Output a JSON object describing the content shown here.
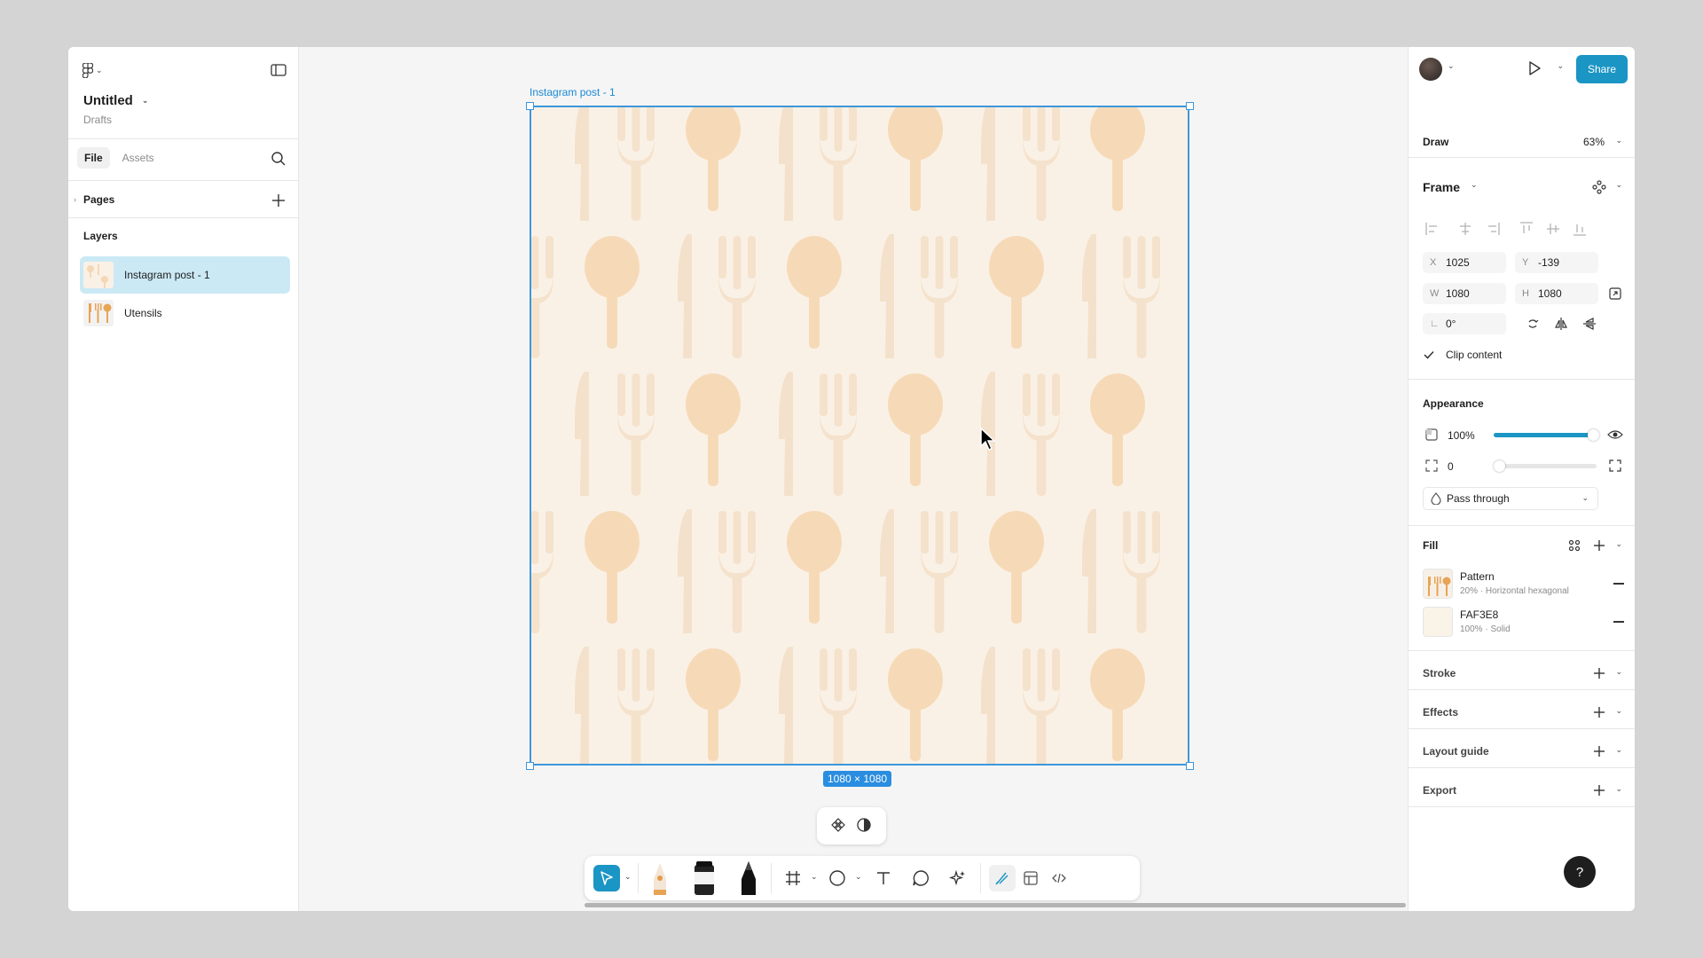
{
  "file": {
    "title": "Untitled",
    "location": "Drafts"
  },
  "left_panel": {
    "tabs": [
      {
        "label": "File"
      },
      {
        "label": "Assets"
      }
    ],
    "pages_label": "Pages",
    "layers_label": "Layers",
    "layers": [
      {
        "label": "Instagram post - 1",
        "selected": true
      },
      {
        "label": "Utensils",
        "selected": false
      }
    ]
  },
  "canvas": {
    "frame_label": "Instagram post - 1",
    "dims_badge": "1080 × 1080",
    "background_color": "#FAF1E6",
    "selection_color": "#3D97DB"
  },
  "toolbar": {
    "tools": [
      "move-icon",
      "pen-icon",
      "marker-icon",
      "pencil-icon",
      "frame-icon",
      "ellipse-icon",
      "text-icon",
      "comment-icon",
      "ai-icon",
      "draw-mode-icon",
      "design-mode-icon",
      "dev-mode-icon"
    ]
  },
  "right_panel": {
    "share_label": "Share",
    "mode_label": "Draw",
    "zoom": "63%",
    "frame_label": "Frame",
    "position": {
      "x_label": "X",
      "x": "1025",
      "y_label": "Y",
      "y": "-139"
    },
    "size": {
      "w_label": "W",
      "w": "1080",
      "h_label": "H",
      "h": "1080"
    },
    "rotation": "0°",
    "clip_content": "Clip content",
    "appearance_label": "Appearance",
    "opacity": "100%",
    "opacity_level": 1.0,
    "corner_radius": "0",
    "blend_mode": "Pass through",
    "fill_label": "Fill",
    "fills": [
      {
        "name": "Pattern",
        "detail": "20% · Horizontal hexagonal"
      },
      {
        "name": "FAF3E8",
        "detail": "100% · Solid",
        "color": "#FAF3E8"
      }
    ],
    "stroke_label": "Stroke",
    "effects_label": "Effects",
    "layout_guide_label": "Layout guide",
    "export_label": "Export",
    "accent_color": "#1A95C4"
  },
  "help_label": "?"
}
